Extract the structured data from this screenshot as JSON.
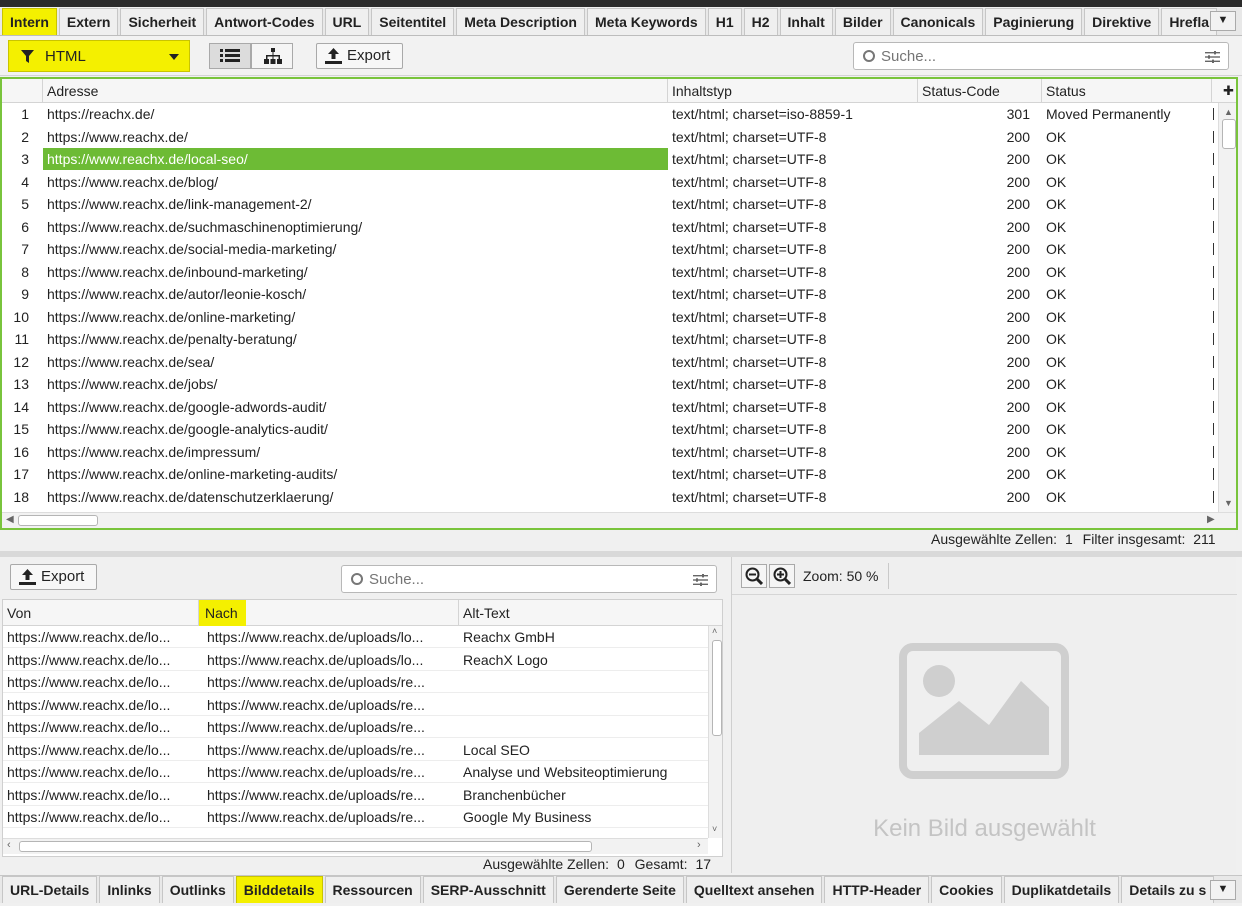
{
  "top_tabs": [
    "Intern",
    "Extern",
    "Sicherheit",
    "Antwort-Codes",
    "URL",
    "Seitentitel",
    "Meta Description",
    "Meta Keywords",
    "H1",
    "H2",
    "Inhalt",
    "Bilder",
    "Canonicals",
    "Paginierung",
    "Direktive",
    "Hrefla"
  ],
  "toolbar": {
    "filter_value": "HTML",
    "export_label": "Export",
    "search_placeholder": "Suche..."
  },
  "main_table": {
    "columns": [
      "Adresse",
      "Inhaltstyp",
      "Status-Code",
      "Status"
    ],
    "rows": [
      {
        "n": "1",
        "url": "https://reachx.de/",
        "type": "text/html; charset=iso-8859-1",
        "code": "301",
        "status": "Moved Permanently"
      },
      {
        "n": "2",
        "url": "https://www.reachx.de/",
        "type": "text/html; charset=UTF-8",
        "code": "200",
        "status": "OK"
      },
      {
        "n": "3",
        "url": "https://www.reachx.de/local-seo/",
        "type": "text/html; charset=UTF-8",
        "code": "200",
        "status": "OK"
      },
      {
        "n": "4",
        "url": "https://www.reachx.de/blog/",
        "type": "text/html; charset=UTF-8",
        "code": "200",
        "status": "OK"
      },
      {
        "n": "5",
        "url": "https://www.reachx.de/link-management-2/",
        "type": "text/html; charset=UTF-8",
        "code": "200",
        "status": "OK"
      },
      {
        "n": "6",
        "url": "https://www.reachx.de/suchmaschinenoptimierung/",
        "type": "text/html; charset=UTF-8",
        "code": "200",
        "status": "OK"
      },
      {
        "n": "7",
        "url": "https://www.reachx.de/social-media-marketing/",
        "type": "text/html; charset=UTF-8",
        "code": "200",
        "status": "OK"
      },
      {
        "n": "8",
        "url": "https://www.reachx.de/inbound-marketing/",
        "type": "text/html; charset=UTF-8",
        "code": "200",
        "status": "OK"
      },
      {
        "n": "9",
        "url": "https://www.reachx.de/autor/leonie-kosch/",
        "type": "text/html; charset=UTF-8",
        "code": "200",
        "status": "OK"
      },
      {
        "n": "10",
        "url": "https://www.reachx.de/online-marketing/",
        "type": "text/html; charset=UTF-8",
        "code": "200",
        "status": "OK"
      },
      {
        "n": "11",
        "url": "https://www.reachx.de/penalty-beratung/",
        "type": "text/html; charset=UTF-8",
        "code": "200",
        "status": "OK"
      },
      {
        "n": "12",
        "url": "https://www.reachx.de/sea/",
        "type": "text/html; charset=UTF-8",
        "code": "200",
        "status": "OK"
      },
      {
        "n": "13",
        "url": "https://www.reachx.de/jobs/",
        "type": "text/html; charset=UTF-8",
        "code": "200",
        "status": "OK"
      },
      {
        "n": "14",
        "url": "https://www.reachx.de/google-adwords-audit/",
        "type": "text/html; charset=UTF-8",
        "code": "200",
        "status": "OK"
      },
      {
        "n": "15",
        "url": "https://www.reachx.de/google-analytics-audit/",
        "type": "text/html; charset=UTF-8",
        "code": "200",
        "status": "OK"
      },
      {
        "n": "16",
        "url": "https://www.reachx.de/impressum/",
        "type": "text/html; charset=UTF-8",
        "code": "200",
        "status": "OK"
      },
      {
        "n": "17",
        "url": "https://www.reachx.de/online-marketing-audits/",
        "type": "text/html; charset=UTF-8",
        "code": "200",
        "status": "OK"
      },
      {
        "n": "18",
        "url": "https://www.reachx.de/datenschutzerklaerung/",
        "type": "text/html; charset=UTF-8",
        "code": "200",
        "status": "OK"
      }
    ],
    "status_selected_label": "Ausgewählte Zellen:",
    "status_selected_value": "1",
    "status_total_label": "Filter insgesamt:",
    "status_total_value": "211"
  },
  "detail": {
    "export_label": "Export",
    "search_placeholder": "Suche...",
    "columns": [
      "Von",
      "Nach",
      "Alt-Text"
    ],
    "rows": [
      {
        "von": "https://www.reachx.de/lo...",
        "nach": "https://www.reachx.de/uploads/lo...",
        "alt": "Reachx GmbH"
      },
      {
        "von": "https://www.reachx.de/lo...",
        "nach": "https://www.reachx.de/uploads/lo...",
        "alt": "ReachX Logo"
      },
      {
        "von": "https://www.reachx.de/lo...",
        "nach": "https://www.reachx.de/uploads/re...",
        "alt": ""
      },
      {
        "von": "https://www.reachx.de/lo...",
        "nach": "https://www.reachx.de/uploads/re...",
        "alt": ""
      },
      {
        "von": "https://www.reachx.de/lo...",
        "nach": "https://www.reachx.de/uploads/re...",
        "alt": ""
      },
      {
        "von": "https://www.reachx.de/lo...",
        "nach": "https://www.reachx.de/uploads/re...",
        "alt": "Local SEO"
      },
      {
        "von": "https://www.reachx.de/lo...",
        "nach": "https://www.reachx.de/uploads/re...",
        "alt": "Analyse und Websiteoptimierung"
      },
      {
        "von": "https://www.reachx.de/lo...",
        "nach": "https://www.reachx.de/uploads/re...",
        "alt": "Branchenbücher"
      },
      {
        "von": "https://www.reachx.de/lo...",
        "nach": "https://www.reachx.de/uploads/re...",
        "alt": "Google My Business"
      }
    ],
    "status_selected_label": "Ausgewählte Zellen:",
    "status_selected_value": "0",
    "status_total_label": "Gesamt:",
    "status_total_value": "17"
  },
  "preview": {
    "zoom_label": "Zoom: 50 %",
    "empty_text": "Kein Bild ausgewählt"
  },
  "bottom_tabs": [
    "URL-Details",
    "Inlinks",
    "Outlinks",
    "Bilddetails",
    "Ressourcen",
    "SERP-Ausschnitt",
    "Gerenderte Seite",
    "Quelltext ansehen",
    "HTTP-Header",
    "Cookies",
    "Duplikatdetails",
    "Details zu s"
  ],
  "colors": {
    "highlight": "#f4f000",
    "selected_row": "#6dbb35",
    "grid_border": "#79c43c"
  }
}
